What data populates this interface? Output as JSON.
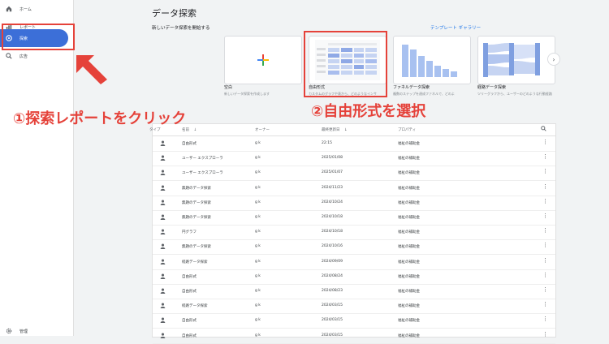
{
  "sidebar": {
    "items": [
      {
        "label": "ホーム",
        "icon": "home-icon"
      },
      {
        "label": "レポート",
        "icon": "reports-icon"
      },
      {
        "label": "探索",
        "icon": "explore-icon"
      },
      {
        "label": "広告",
        "icon": "ads-icon"
      }
    ],
    "admin_label": "管理"
  },
  "header": {
    "title": "データ探索",
    "subhead": "新しいデータ探索を開始する",
    "gallery_link": "テンプレート ギャラリー"
  },
  "templates": [
    {
      "label": "空白",
      "desc": "新しいデータ探索を作成します"
    },
    {
      "label": "自由形式",
      "desc": "カスタムのグラフや表から、どのようなインサ"
    },
    {
      "label": "ファネルデータ探索",
      "desc": "複数のステップを達成ファネルで、どのよ"
    },
    {
      "label": "経路データ探索",
      "desc": "ツリーグラフから、ユーザーのどのような行動経路が"
    }
  ],
  "annotations": {
    "step1": "①探索レポートをクリック",
    "step2": "②自由形式を選択"
  },
  "table": {
    "headers": {
      "type": "タイプ",
      "name": "名前",
      "owner": "オーナー",
      "modified": "最終更新日",
      "property": "プロパティ"
    },
    "rows": [
      {
        "name": "自由形式",
        "owner": "g k",
        "modified": "22:15",
        "property": "福祉の補助金"
      },
      {
        "name": "ユーザー エクスプローラ",
        "owner": "g k",
        "modified": "2025/01/08",
        "property": "福祉の補助金"
      },
      {
        "name": "ユーザー エクスプローラ",
        "owner": "g k",
        "modified": "2025/01/07",
        "property": "福祉の補助金"
      },
      {
        "name": "無題のデータ探索",
        "owner": "g k",
        "modified": "2024/11/23",
        "property": "福祉の補助金"
      },
      {
        "name": "無題のデータ探索",
        "owner": "g k",
        "modified": "2024/10/24",
        "property": "福祉の補助金"
      },
      {
        "name": "無題のデータ探索",
        "owner": "g k",
        "modified": "2024/10/18",
        "property": "福祉の補助金"
      },
      {
        "name": "円グラフ",
        "owner": "g k",
        "modified": "2024/10/18",
        "property": "福祉の補助金"
      },
      {
        "name": "無題のデータ探索",
        "owner": "g k",
        "modified": "2024/10/16",
        "property": "福祉の補助金"
      },
      {
        "name": "経路データ探索",
        "owner": "g k",
        "modified": "2024/09/09",
        "property": "福祉の補助金"
      },
      {
        "name": "自由形式",
        "owner": "g k",
        "modified": "2024/08/24",
        "property": "福祉の補助金"
      },
      {
        "name": "自由形式",
        "owner": "g k",
        "modified": "2024/08/23",
        "property": "福祉の補助金"
      },
      {
        "name": "経路データ探索",
        "owner": "g k",
        "modified": "2024/03/15",
        "property": "福祉の補助金"
      },
      {
        "name": "自由形式",
        "owner": "g k",
        "modified": "2024/03/15",
        "property": "福祉の補助金"
      },
      {
        "name": "自由形式",
        "owner": "g k",
        "modified": "2024/03/15",
        "property": "福祉の補助金"
      }
    ]
  },
  "colors": {
    "accent": "#3c6fd8",
    "annotation": "#e5423a",
    "link": "#1a73e8"
  }
}
